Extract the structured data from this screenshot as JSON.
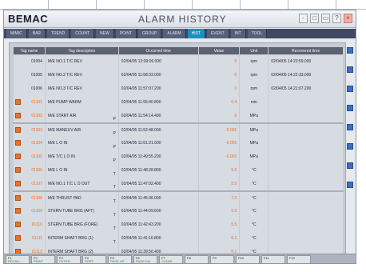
{
  "app": {
    "logo": "BEMAC",
    "title": "ALARM HISTORY"
  },
  "window_buttons": [
    "-",
    "□",
    "▭",
    "?",
    "×"
  ],
  "nav": {
    "tabs": [
      "MIMIC",
      "BAR",
      "TREND",
      "COUNT",
      "NEW",
      "POINT",
      "GROUP",
      "ALARM",
      "HIST",
      "EVENT",
      "INT",
      "TOOL"
    ],
    "active": "HIST"
  },
  "table": {
    "headers": [
      "Tag name",
      "Tag description",
      "Occurred time",
      "Value",
      "Unit",
      "Recovered time"
    ],
    "rows": [
      {
        "tag": "01004",
        "desc": "M/E NO.1 T/C REV",
        "suf": "",
        "occurred": "02/04/05 12:09:06.000",
        "value": "0",
        "unit": "rpm",
        "recovered": "02/04/05 14:23:59.000",
        "alarm": false,
        "sep": false
      },
      {
        "tag": "01005",
        "desc": "M/E NO.2 T/C REV",
        "suf": "",
        "occurred": "02/04/05 11:58:33.000",
        "value": "0",
        "unit": "rpm",
        "recovered": "02/04/05 14:22:33.000",
        "alarm": false,
        "sep": false
      },
      {
        "tag": "01006",
        "desc": "M/E NO.3 T/C REV",
        "suf": "",
        "occurred": "02/04/05 11:57:07.200",
        "value": "0",
        "unit": "rpm",
        "recovered": "02/04/05 14:21:07.200",
        "alarm": false,
        "sep": false
      },
      {
        "tag": "01101",
        "desc": "M/E PUMP WARM",
        "suf": "",
        "occurred": "02/04/05 11:55:40.800",
        "value": "0.4",
        "unit": "min",
        "recovered": "",
        "alarm": true,
        "sep": false
      },
      {
        "tag": "01102",
        "desc": "M/E START AIR",
        "suf": "P",
        "occurred": "02/04/05 11:54:14.400",
        "value": "0",
        "unit": "MPa",
        "recovered": "",
        "alarm": true,
        "sep": false
      },
      {
        "tag": "01103",
        "desc": "M/E MANEUV AIR",
        "suf": "P",
        "occurred": "02/04/05 11:52:48.000",
        "value": "-0.001",
        "unit": "MPa",
        "recovered": "",
        "alarm": true,
        "sep": true
      },
      {
        "tag": "01104",
        "desc": "M/E L O IN",
        "suf": "P",
        "occurred": "02/04/05 11:51:21.600",
        "value": "-0.001",
        "unit": "MPa",
        "recovered": "",
        "alarm": true,
        "sep": false
      },
      {
        "tag": "01105",
        "desc": "M/E T/C L O IN",
        "suf": "P",
        "occurred": "02/04/05 11:49:55.200",
        "value": "-0.001",
        "unit": "MPa",
        "recovered": "",
        "alarm": true,
        "sep": false
      },
      {
        "tag": "01106",
        "desc": "M/E L O IN",
        "suf": "T",
        "occurred": "02/04/05 11:48:28.800",
        "value": "5.5",
        "unit": "°C",
        "recovered": "",
        "alarm": true,
        "sep": false
      },
      {
        "tag": "01107",
        "desc": "M/E NO.1 T/C L O OUT",
        "suf": "T",
        "occurred": "02/04/05 11:47:02.400",
        "value": "5.5",
        "unit": "°C",
        "recovered": "",
        "alarm": true,
        "sep": false
      },
      {
        "tag": "01108",
        "desc": "M/E THRUST PAD",
        "suf": "T",
        "occurred": "02/04/05 11:45:36.000",
        "value": "7.0",
        "unit": "°C",
        "recovered": "",
        "alarm": true,
        "sep": true
      },
      {
        "tag": "01109",
        "desc": "STERN TUBE BRG (AFT)",
        "suf": "T",
        "occurred": "02/04/05 11:44:09.600",
        "value": "5.5",
        "unit": "°C",
        "recovered": "",
        "alarm": true,
        "sep": false
      },
      {
        "tag": "01110",
        "desc": "STERN TUBE BRG (FORE)",
        "suf": "T",
        "occurred": "02/04/05 11:42:43.200",
        "value": "5.5",
        "unit": "°C",
        "recovered": "",
        "alarm": true,
        "sep": false
      },
      {
        "tag": "01111",
        "desc": "INTERM SHAFT BRG (1)",
        "suf": "T",
        "occurred": "02/04/05 11:41:16.800",
        "value": "6.1",
        "unit": "°C",
        "recovered": "",
        "alarm": true,
        "sep": false
      },
      {
        "tag": "01112",
        "desc": "INTERM SHAFT BRG (2)",
        "suf": "T",
        "occurred": "02/04/05 11:39:50.400",
        "value": "6.1",
        "unit": "°C",
        "recovered": "",
        "alarm": true,
        "sep": false
      }
    ]
  },
  "function_keys": [
    {
      "key": "F1",
      "label": "RECALL"
    },
    {
      "key": "F2",
      "label": "PRINT"
    },
    {
      "key": "F3",
      "label": "FILTER"
    },
    {
      "key": "F4",
      "label": "SORT"
    },
    {
      "key": "F5",
      "label": "PAGE UP"
    },
    {
      "key": "F6",
      "label": "PAGE DN"
    },
    {
      "key": "F7",
      "label": "CLEAR"
    },
    {
      "key": "F8",
      "label": ""
    },
    {
      "key": "F9",
      "label": ""
    },
    {
      "key": "F10",
      "label": ""
    },
    {
      "key": "F11",
      "label": ""
    },
    {
      "key": "F12",
      "label": ""
    }
  ],
  "colors": {
    "alarm": "#e8722a",
    "nav_active": "#1f8fc2",
    "header_bg": "#5b6270"
  }
}
